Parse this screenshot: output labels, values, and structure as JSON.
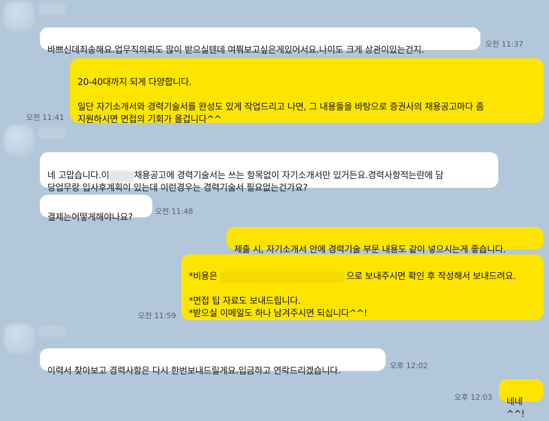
{
  "messages": [
    {
      "text": "바쁘신데죄송해요.업무직의뢰도 많이 받으실텐데 여쭤보고싶은게있어서요.나이도 크게 상관이있는건지.",
      "time": "오전 11:37"
    },
    {
      "text": "20-40대까지 되게 다양합니다.\n\n일단 자기소개서와 경력기술서를 완성도 있게 작업드리고 나면, 그 내용들을 바탕으로 증권사의 채용공고마다 좀\n지원하시면 면접의 기회가 올겁니다^^",
      "time": "오전 11:41"
    },
    {
      "text_a": "네 고맙습니다.이",
      "text_b": "채용공고에 경력기술서는 쓰는 항목없이 자기소개서만 있거든요.경력사항적는란에 담\n당업무랑 입사후계획이 있는데 이런경우는 경력기술서 필요없는건가요?"
    },
    {
      "text": "결제는어떻게해야나요?",
      "time": "오전 11:48"
    },
    {
      "text": "제출 시, 자기소개서 안에 경력기술 부문 내용도 같이 넣으시는게 좋습니다."
    },
    {
      "text_a": "*비용은",
      "text_b": "으로 보내주시면 확인 후 작성해서 보내드려요.",
      "text_c": "*면접 팁 자료도 보내드립니다.\n*받으실 이메일도 하나 남겨주시면 되십니다^^!",
      "time": "오전 11:59"
    },
    {
      "text": "이력서 찾아보고 경력사항은 다시 한번보내드릴게요.입금하고 연락드리겠습니다.",
      "time": "오후 12:02"
    },
    {
      "text": "네네^^!",
      "time": "오후 12:03"
    }
  ]
}
